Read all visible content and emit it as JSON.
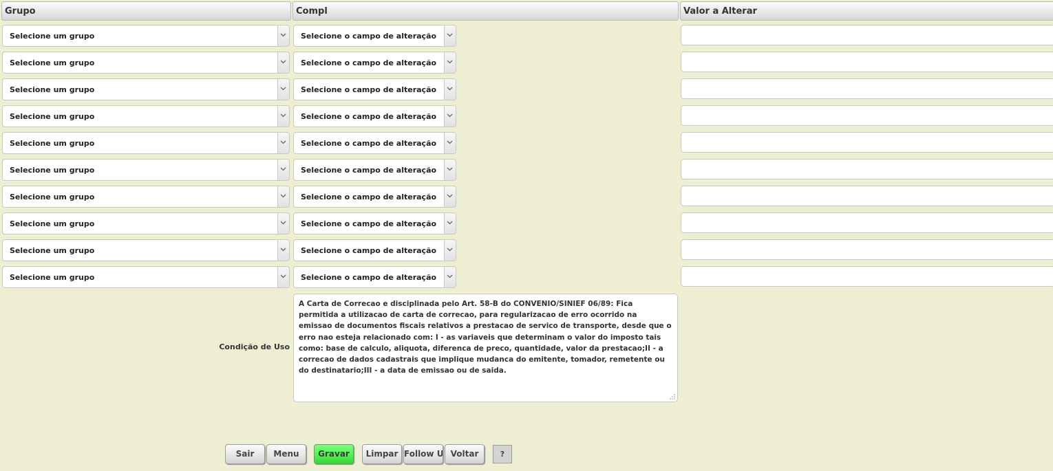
{
  "headers": {
    "grupo": "Grupo",
    "compl": "Compl",
    "valor": "Valor a Alterar"
  },
  "rows": [
    {
      "grupo": "Selecione um grupo",
      "compl": "Selecione o campo de alteração",
      "valor": ""
    },
    {
      "grupo": "Selecione um grupo",
      "compl": "Selecione o campo de alteração",
      "valor": ""
    },
    {
      "grupo": "Selecione um grupo",
      "compl": "Selecione o campo de alteração",
      "valor": ""
    },
    {
      "grupo": "Selecione um grupo",
      "compl": "Selecione o campo de alteração",
      "valor": ""
    },
    {
      "grupo": "Selecione um grupo",
      "compl": "Selecione o campo de alteração",
      "valor": ""
    },
    {
      "grupo": "Selecione um grupo",
      "compl": "Selecione o campo de alteração",
      "valor": ""
    },
    {
      "grupo": "Selecione um grupo",
      "compl": "Selecione o campo de alteração",
      "valor": ""
    },
    {
      "grupo": "Selecione um grupo",
      "compl": "Selecione o campo de alteração",
      "valor": ""
    },
    {
      "grupo": "Selecione um grupo",
      "compl": "Selecione o campo de alteração",
      "valor": ""
    },
    {
      "grupo": "Selecione um grupo",
      "compl": "Selecione o campo de alteração",
      "valor": ""
    }
  ],
  "condicao": {
    "label": "Condição de Uso",
    "text": "A Carta de Correcao e disciplinada pelo Art. 58-B do CONVENIO/SINIEF 06/89: Fica permitida a utilizacao de carta de correcao, para regularizacao de erro ocorrido na emissao de documentos fiscais relativos a prestacao de servico de transporte, desde que o erro nao esteja relacionado com: I - as variaveis que determinam o valor do imposto tais como: base de calculo, aliquota, diferenca de preco, quantidade, valor da prestacao;II - a correcao de dados cadastrais que implique mudanca do emitente, tomador, remetente ou do destinatario;III - a data de emissao ou de saida."
  },
  "buttons": {
    "sair": "Sair",
    "menu": "Menu",
    "gravar": "Gravar",
    "limpar": "Limpar",
    "follow_up": "Follow Up",
    "voltar": "Voltar",
    "help": "?"
  },
  "colors": {
    "background": "#eeeed3",
    "gravar": "#4ef04e"
  },
  "icons": {
    "select_arrow": "chevron-down-icon",
    "resize_grip": "resize-grip-icon"
  }
}
